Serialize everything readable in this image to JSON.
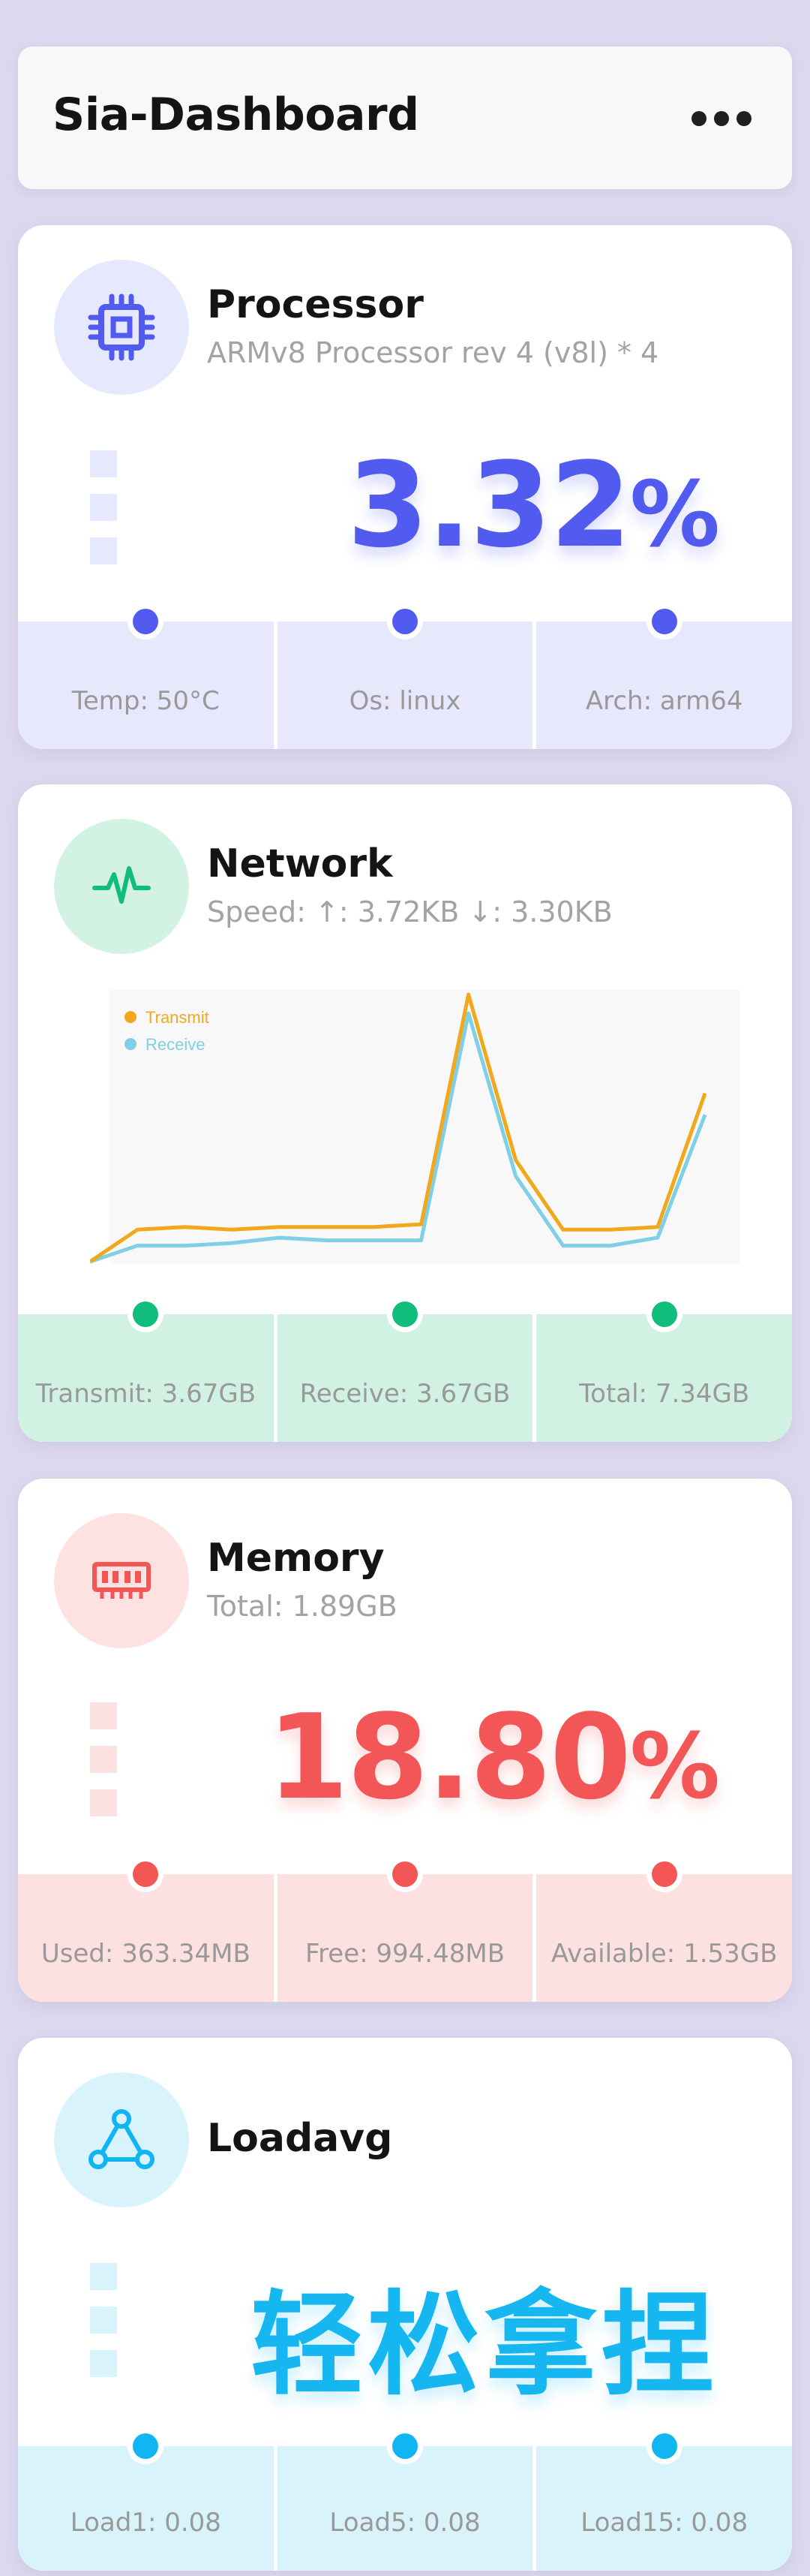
{
  "header": {
    "title": "Sia-Dashboard",
    "menu_icon": "more-horizontal-icon"
  },
  "processor": {
    "icon": "cpu-icon",
    "title": "Processor",
    "subtitle": "ARMv8 Processor rev 4 (v8l) * 4",
    "usage": "3.32",
    "unit": "%",
    "accent": "#525bf0",
    "stats": [
      "Temp: 50°C",
      "Os: linux",
      "Arch: arm64"
    ]
  },
  "network": {
    "icon": "activity-pulse-icon",
    "title": "Network",
    "subtitle": "Speed: ↑: 3.72KB ↓: 3.30KB",
    "accent": "#10bd7c",
    "stats": [
      "Transmit: 3.67GB",
      "Receive: 3.67GB",
      "Total: 7.34GB"
    ]
  },
  "chart_data": {
    "type": "line",
    "x": [
      1,
      2,
      3,
      4,
      5,
      6,
      7,
      8,
      9,
      10,
      11,
      12,
      13,
      14
    ],
    "series": [
      {
        "name": "Transmit",
        "color": "#f2a81d",
        "values": [
          0,
          12,
          13,
          12,
          13,
          13,
          13,
          14,
          100,
          38,
          12,
          12,
          13,
          63
        ]
      },
      {
        "name": "Receive",
        "color": "#7fd0e6",
        "values": [
          0,
          6,
          6,
          7,
          9,
          8,
          8,
          8,
          93,
          32,
          6,
          6,
          9,
          55
        ]
      }
    ],
    "ylim": [
      0,
      100
    ],
    "legend": "top-left",
    "grid": false
  },
  "memory": {
    "icon": "ram-icon",
    "title": "Memory",
    "subtitle": "Total: 1.89GB",
    "usage": "18.80",
    "unit": "%",
    "accent": "#f25656",
    "stats": [
      "Used: 363.34MB",
      "Free: 994.48MB",
      "Available: 1.53GB"
    ]
  },
  "loadavg": {
    "icon": "triangle-nodes-icon",
    "title": "Loadavg",
    "slogan": "轻松拿捏",
    "accent": "#16b6f0",
    "stats": [
      "Load1: 0.08",
      "Load5: 0.08",
      "Load15: 0.08"
    ]
  }
}
